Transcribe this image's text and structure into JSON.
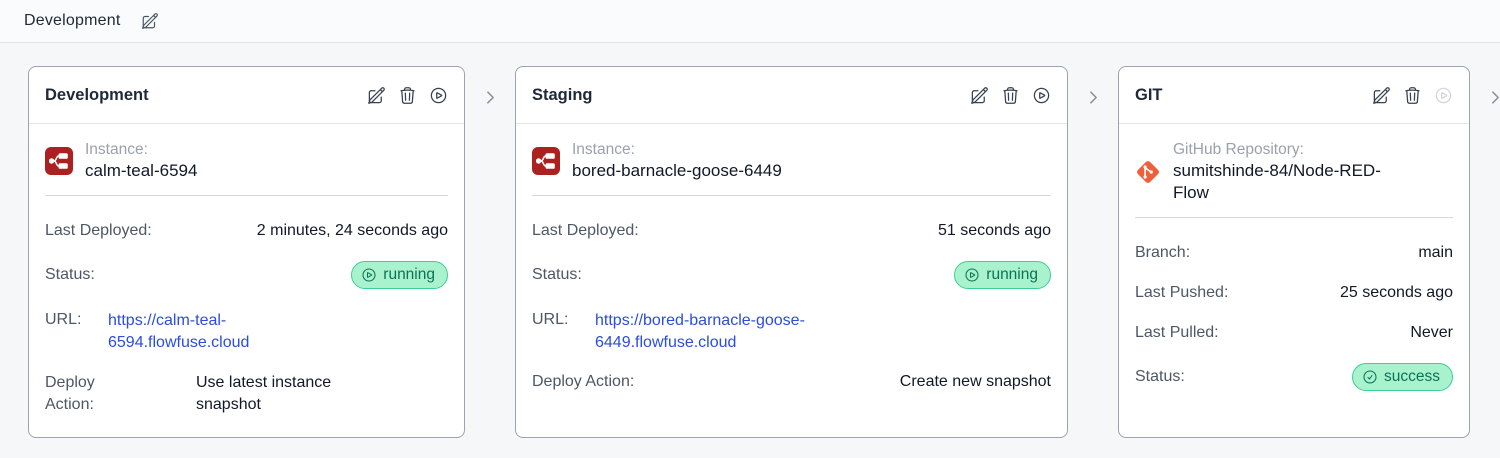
{
  "topbar": {
    "title": "Development"
  },
  "pipeline": {
    "stages": [
      {
        "title": "Development",
        "source": {
          "label": "Instance:",
          "value": "calm-teal-6594"
        },
        "last_deployed_label": "Last Deployed:",
        "last_deployed": "2 minutes, 24 seconds ago",
        "status_label": "Status:",
        "status": "running",
        "url_label": "URL:",
        "url": "https://calm-teal-6594.flowfuse.cloud",
        "deploy_action_label": "Deploy Action:",
        "deploy_action": "Use latest instance snapshot"
      },
      {
        "title": "Staging",
        "source": {
          "label": "Instance:",
          "value": "bored-barnacle-goose-6449"
        },
        "last_deployed_label": "Last Deployed:",
        "last_deployed": "51 seconds ago",
        "status_label": "Status:",
        "status": "running",
        "url_label": "URL:",
        "url": "https://bored-barnacle-goose-6449.flowfuse.cloud",
        "deploy_action_label": "Deploy Action:",
        "deploy_action": "Create new snapshot"
      },
      {
        "title": "GIT",
        "source": {
          "label": "GitHub Repository:",
          "value": "sumitshinde-84/Node-RED-Flow"
        },
        "branch_label": "Branch:",
        "branch": "main",
        "last_pushed_label": "Last Pushed:",
        "last_pushed": "25 seconds ago",
        "last_pulled_label": "Last Pulled:",
        "last_pulled": "Never",
        "status_label": "Status:",
        "status": "success"
      }
    ]
  },
  "colors": {
    "badge_bg": "#a9f2ce",
    "badge_border": "#3bd093",
    "badge_text": "#0b7355",
    "link_blue": "#2b4ce0",
    "node_red_red": "#ad2020",
    "git_orange": "#ee5f3b",
    "card_border": "#9ca3af"
  }
}
